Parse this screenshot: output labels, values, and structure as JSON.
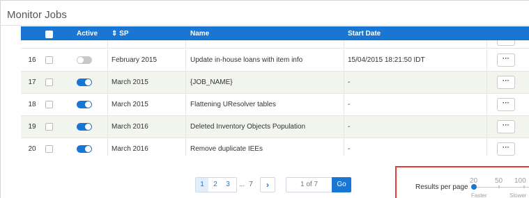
{
  "page": {
    "title": "Monitor Jobs"
  },
  "table": {
    "headers": {
      "active": "Active",
      "sp": "SP",
      "name": "Name",
      "start_date": "Start Date"
    },
    "sort_icon": "sort-arrows-icon",
    "rows": [
      {
        "num": "16",
        "active": false,
        "sp": "February 2015",
        "name": "Update in-house loans with item info",
        "start_date": "15/04/2015 18:21:50 IDT",
        "actions": "···"
      },
      {
        "num": "17",
        "active": true,
        "sp": "March 2015",
        "name": "{JOB_NAME}",
        "start_date": "-",
        "actions": "···"
      },
      {
        "num": "18",
        "active": true,
        "sp": "March 2015",
        "name": "Flattening UResolver tables",
        "start_date": "-",
        "actions": "···"
      },
      {
        "num": "19",
        "active": true,
        "sp": "March 2016",
        "name": "Deleted Inventory Objects Population",
        "start_date": "-",
        "actions": "···"
      },
      {
        "num": "20",
        "active": true,
        "sp": "March 2016",
        "name": "Remove duplicate IEEs",
        "start_date": "-",
        "actions": "···"
      }
    ]
  },
  "pagination": {
    "pages": [
      "1",
      "2",
      "3"
    ],
    "ellipsis": "...",
    "last": "7",
    "next_icon": "chevron-right-icon",
    "next": "›",
    "page_input": "1 of 7",
    "go": "Go"
  },
  "results_per_page": {
    "label": "Results per page",
    "options": [
      "20",
      "50",
      "100"
    ],
    "selected": "20",
    "faster": "Faster",
    "slower": "Slower"
  },
  "colors": {
    "accent": "#1976d2",
    "highlight_border": "#e53935",
    "alt_row": "#f1f5ee"
  }
}
